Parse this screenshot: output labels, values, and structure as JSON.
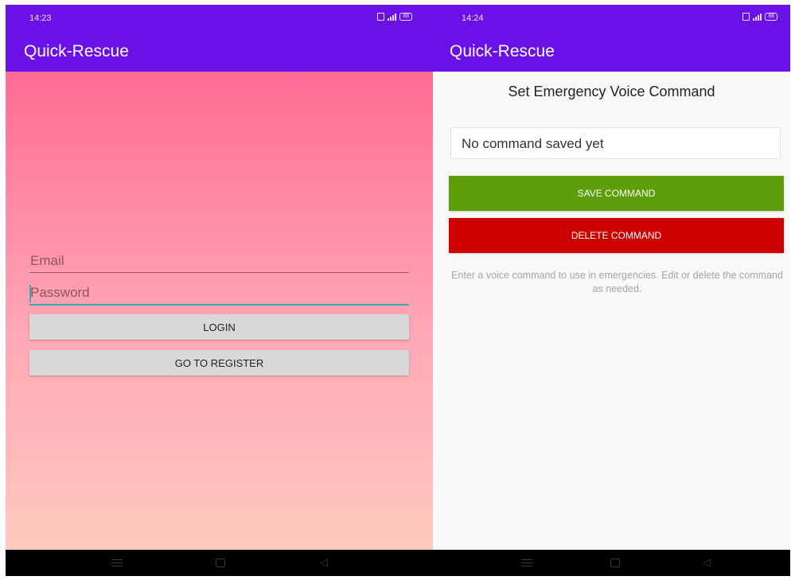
{
  "login_screen": {
    "status_bar": {
      "time": "14:23",
      "battery": "88"
    },
    "app_bar": {
      "title": "Quick-Rescue"
    },
    "form": {
      "email_placeholder": "Email",
      "password_placeholder": "Password",
      "login_label": "LOGIN",
      "register_label": "GO TO REGISTER"
    },
    "colors": {
      "app_bar": "#6a11e8",
      "gradient_top": "#ff6b96",
      "gradient_bottom": "#ffc9bd",
      "button": "#d8d8d8"
    }
  },
  "command_screen": {
    "status_bar": {
      "time": "14:24",
      "battery": "88"
    },
    "app_bar": {
      "title": "Quick-Rescue"
    },
    "heading": "Set Emergency Voice Command",
    "command_input_value": "No command saved yet",
    "save_label": "SAVE COMMAND",
    "delete_label": "DELETE COMMAND",
    "help_text": "Enter a voice command to use in emergencies. Edit or delete the command as needed.",
    "colors": {
      "save": "#5e9e0a",
      "delete": "#cc0000",
      "background": "#f8f8f8"
    }
  },
  "icons": [
    "sim-icon",
    "signal-icon",
    "battery-icon",
    "nav-menu-icon",
    "nav-home-icon",
    "nav-back-icon"
  ]
}
